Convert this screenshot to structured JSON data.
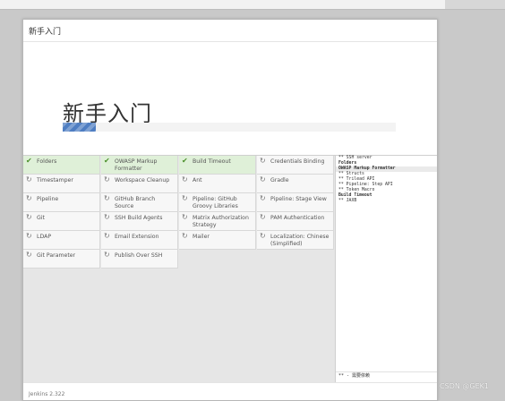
{
  "dialog": {
    "title": "新手入门",
    "heading": "新手入门",
    "progress_fraction": 0.1,
    "version": "Jenkins 2.322"
  },
  "plugins": [
    {
      "label": "Folders",
      "status": "done"
    },
    {
      "label": "OWASP Markup Formatter",
      "status": "done"
    },
    {
      "label": "Build Timeout",
      "status": "done"
    },
    {
      "label": "Credentials Binding",
      "status": "pending"
    },
    {
      "label": "Timestamper",
      "status": "pending"
    },
    {
      "label": "Workspace Cleanup",
      "status": "pending"
    },
    {
      "label": "Ant",
      "status": "pending"
    },
    {
      "label": "Gradle",
      "status": "pending"
    },
    {
      "label": "Pipeline",
      "status": "pending"
    },
    {
      "label": "GitHub Branch Source",
      "status": "pending"
    },
    {
      "label": "Pipeline: GitHub Groovy Libraries",
      "status": "pending"
    },
    {
      "label": "Pipeline: Stage View",
      "status": "pending"
    },
    {
      "label": "Git",
      "status": "pending"
    },
    {
      "label": "SSH Build Agents",
      "status": "pending"
    },
    {
      "label": "Matrix Authorization Strategy",
      "status": "pending"
    },
    {
      "label": "PAM Authentication",
      "status": "pending"
    },
    {
      "label": "LDAP",
      "status": "pending"
    },
    {
      "label": "Email Extension",
      "status": "pending"
    },
    {
      "label": "Mailer",
      "status": "pending"
    },
    {
      "label": "Localization: Chinese (Simplified)",
      "status": "pending"
    },
    {
      "label": "Git Parameter",
      "status": "pending"
    },
    {
      "label": "Publish Over SSH",
      "status": "pending"
    }
  ],
  "log": {
    "lines": [
      {
        "text": "** SSH server",
        "style": "normal"
      },
      {
        "text": "Folders",
        "style": "bold"
      },
      {
        "text": "OWASP Markup Formatter",
        "style": "hl"
      },
      {
        "text": "** Structs",
        "style": "normal"
      },
      {
        "text": "** Trilead API",
        "style": "normal"
      },
      {
        "text": "** Pipeline: Step API",
        "style": "normal"
      },
      {
        "text": "** Token Macro",
        "style": "normal"
      },
      {
        "text": "Build Timeout",
        "style": "bold"
      },
      {
        "text": "** JAXB",
        "style": "normal"
      }
    ],
    "footer": "** - 需要依赖"
  },
  "watermark": "CSDN @GEK1",
  "icons": {
    "done": "check-icon",
    "pending": "refresh-icon"
  },
  "colors": {
    "done_bg": "#dff0d8",
    "check": "#4a8f2a",
    "progress": "#4f7ec2"
  }
}
